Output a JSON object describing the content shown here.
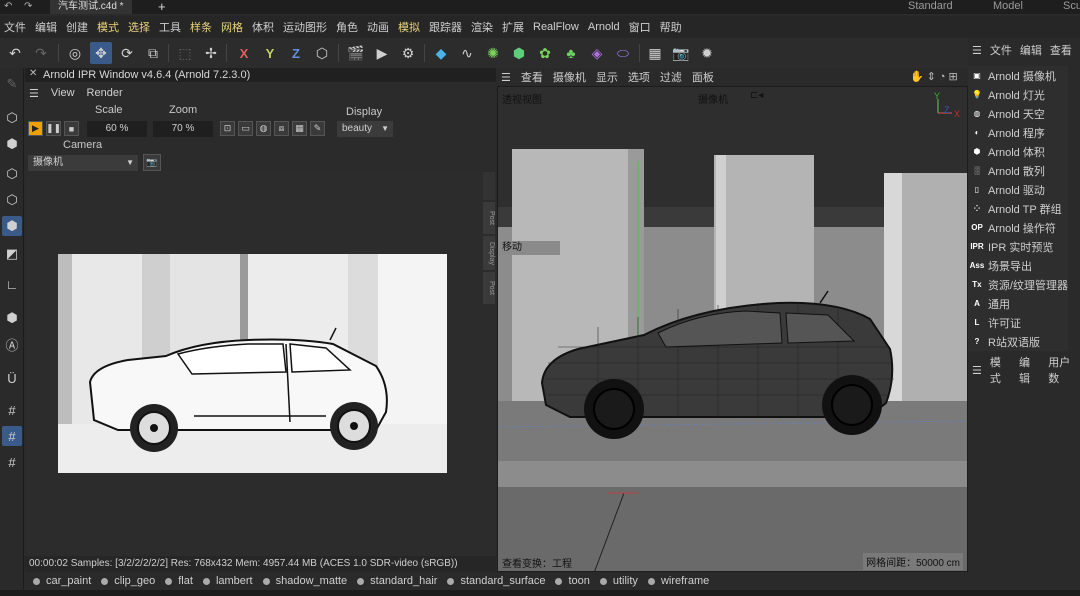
{
  "titlebar": {
    "doc_tab": "汽车测试.c4d *",
    "workspaces": [
      "Standard",
      "Model",
      "Scu"
    ]
  },
  "menu": {
    "items": [
      {
        "label": "文件",
        "highlight": false
      },
      {
        "label": "编辑",
        "highlight": false
      },
      {
        "label": "创建",
        "highlight": false
      },
      {
        "label": "模式",
        "highlight": true
      },
      {
        "label": "选择",
        "highlight": true
      },
      {
        "label": "工具",
        "highlight": false
      },
      {
        "label": "样条",
        "highlight": true
      },
      {
        "label": "网格",
        "highlight": true
      },
      {
        "label": "体积",
        "highlight": false
      },
      {
        "label": "运动图形",
        "highlight": false
      },
      {
        "label": "角色",
        "highlight": false
      },
      {
        "label": "动画",
        "highlight": false
      },
      {
        "label": "模拟",
        "highlight": true
      },
      {
        "label": "跟踪器",
        "highlight": false
      },
      {
        "label": "渲染",
        "highlight": false
      },
      {
        "label": "扩展",
        "highlight": false
      },
      {
        "label": "RealFlow",
        "highlight": false
      },
      {
        "label": "Arnold",
        "highlight": false
      },
      {
        "label": "窗口",
        "highlight": false
      },
      {
        "label": "帮助",
        "highlight": false
      }
    ]
  },
  "toolbar": {
    "axis_x": "X",
    "axis_y": "Y",
    "axis_z": "Z"
  },
  "ipr": {
    "title": "Arnold IPR Window v4.6.4 (Arnold 7.2.3.0)",
    "menu": [
      "View",
      "Render"
    ],
    "scale_label": "Scale",
    "scale_value": "60 %",
    "zoom_label": "Zoom",
    "zoom_value": "70 %",
    "display_label": "Display",
    "display_value": "beauty",
    "camera_label": "Camera",
    "camera_value": "摄像机",
    "side_tabs": [
      "Post",
      "Display",
      "Post"
    ],
    "status": "00:00:02  Samples: [3/2/2/2/2/2]  Res: 768x432  Mem: 4957.44 MB  (ACES 1.0 SDR-video (sRGB))"
  },
  "viewport": {
    "menu": [
      "查看",
      "摄像机",
      "显示",
      "选项",
      "过滤",
      "面板"
    ],
    "view_name": "透视视图",
    "camera_name": "摄像机",
    "tool_hint": "移动",
    "transform_info": "查看变换：工程",
    "grid_spacing": "网格间距：50000 cm",
    "axis_y": "Y",
    "axis_x": "X",
    "axis_z": "Z"
  },
  "right_panel": {
    "header": [
      "文件",
      "编辑",
      "查看"
    ],
    "items": [
      {
        "icon": "camera",
        "label": "Arnold 摄像机"
      },
      {
        "icon": "light",
        "label": "Arnold 灯光"
      },
      {
        "icon": "sky",
        "label": "Arnold 天空"
      },
      {
        "icon": "procedural",
        "label": "Arnold 程序"
      },
      {
        "icon": "volume",
        "label": "Arnold 体积"
      },
      {
        "icon": "scatter",
        "label": "Arnold 散列"
      },
      {
        "icon": "driver",
        "label": "Arnold 驱动"
      },
      {
        "icon": "tp-group",
        "label": "Arnold TP 群组"
      },
      {
        "icon": "OP",
        "label": "Arnold 操作符"
      },
      {
        "icon": "IPR",
        "label": "IPR 实时预览"
      },
      {
        "icon": "Ass",
        "label": "场景导出"
      },
      {
        "icon": "Tx",
        "label": "资源/纹理管理器"
      },
      {
        "icon": "A",
        "label": "通用"
      },
      {
        "icon": "L",
        "label": "许可证"
      },
      {
        "icon": "?",
        "label": "R站双语版"
      }
    ],
    "lower_header": [
      "模式",
      "编辑",
      "用户数"
    ]
  },
  "shaders": [
    "car_paint",
    "clip_geo",
    "flat",
    "lambert",
    "shadow_matte",
    "standard_hair",
    "standard_surface",
    "toon",
    "utility",
    "wireframe"
  ]
}
